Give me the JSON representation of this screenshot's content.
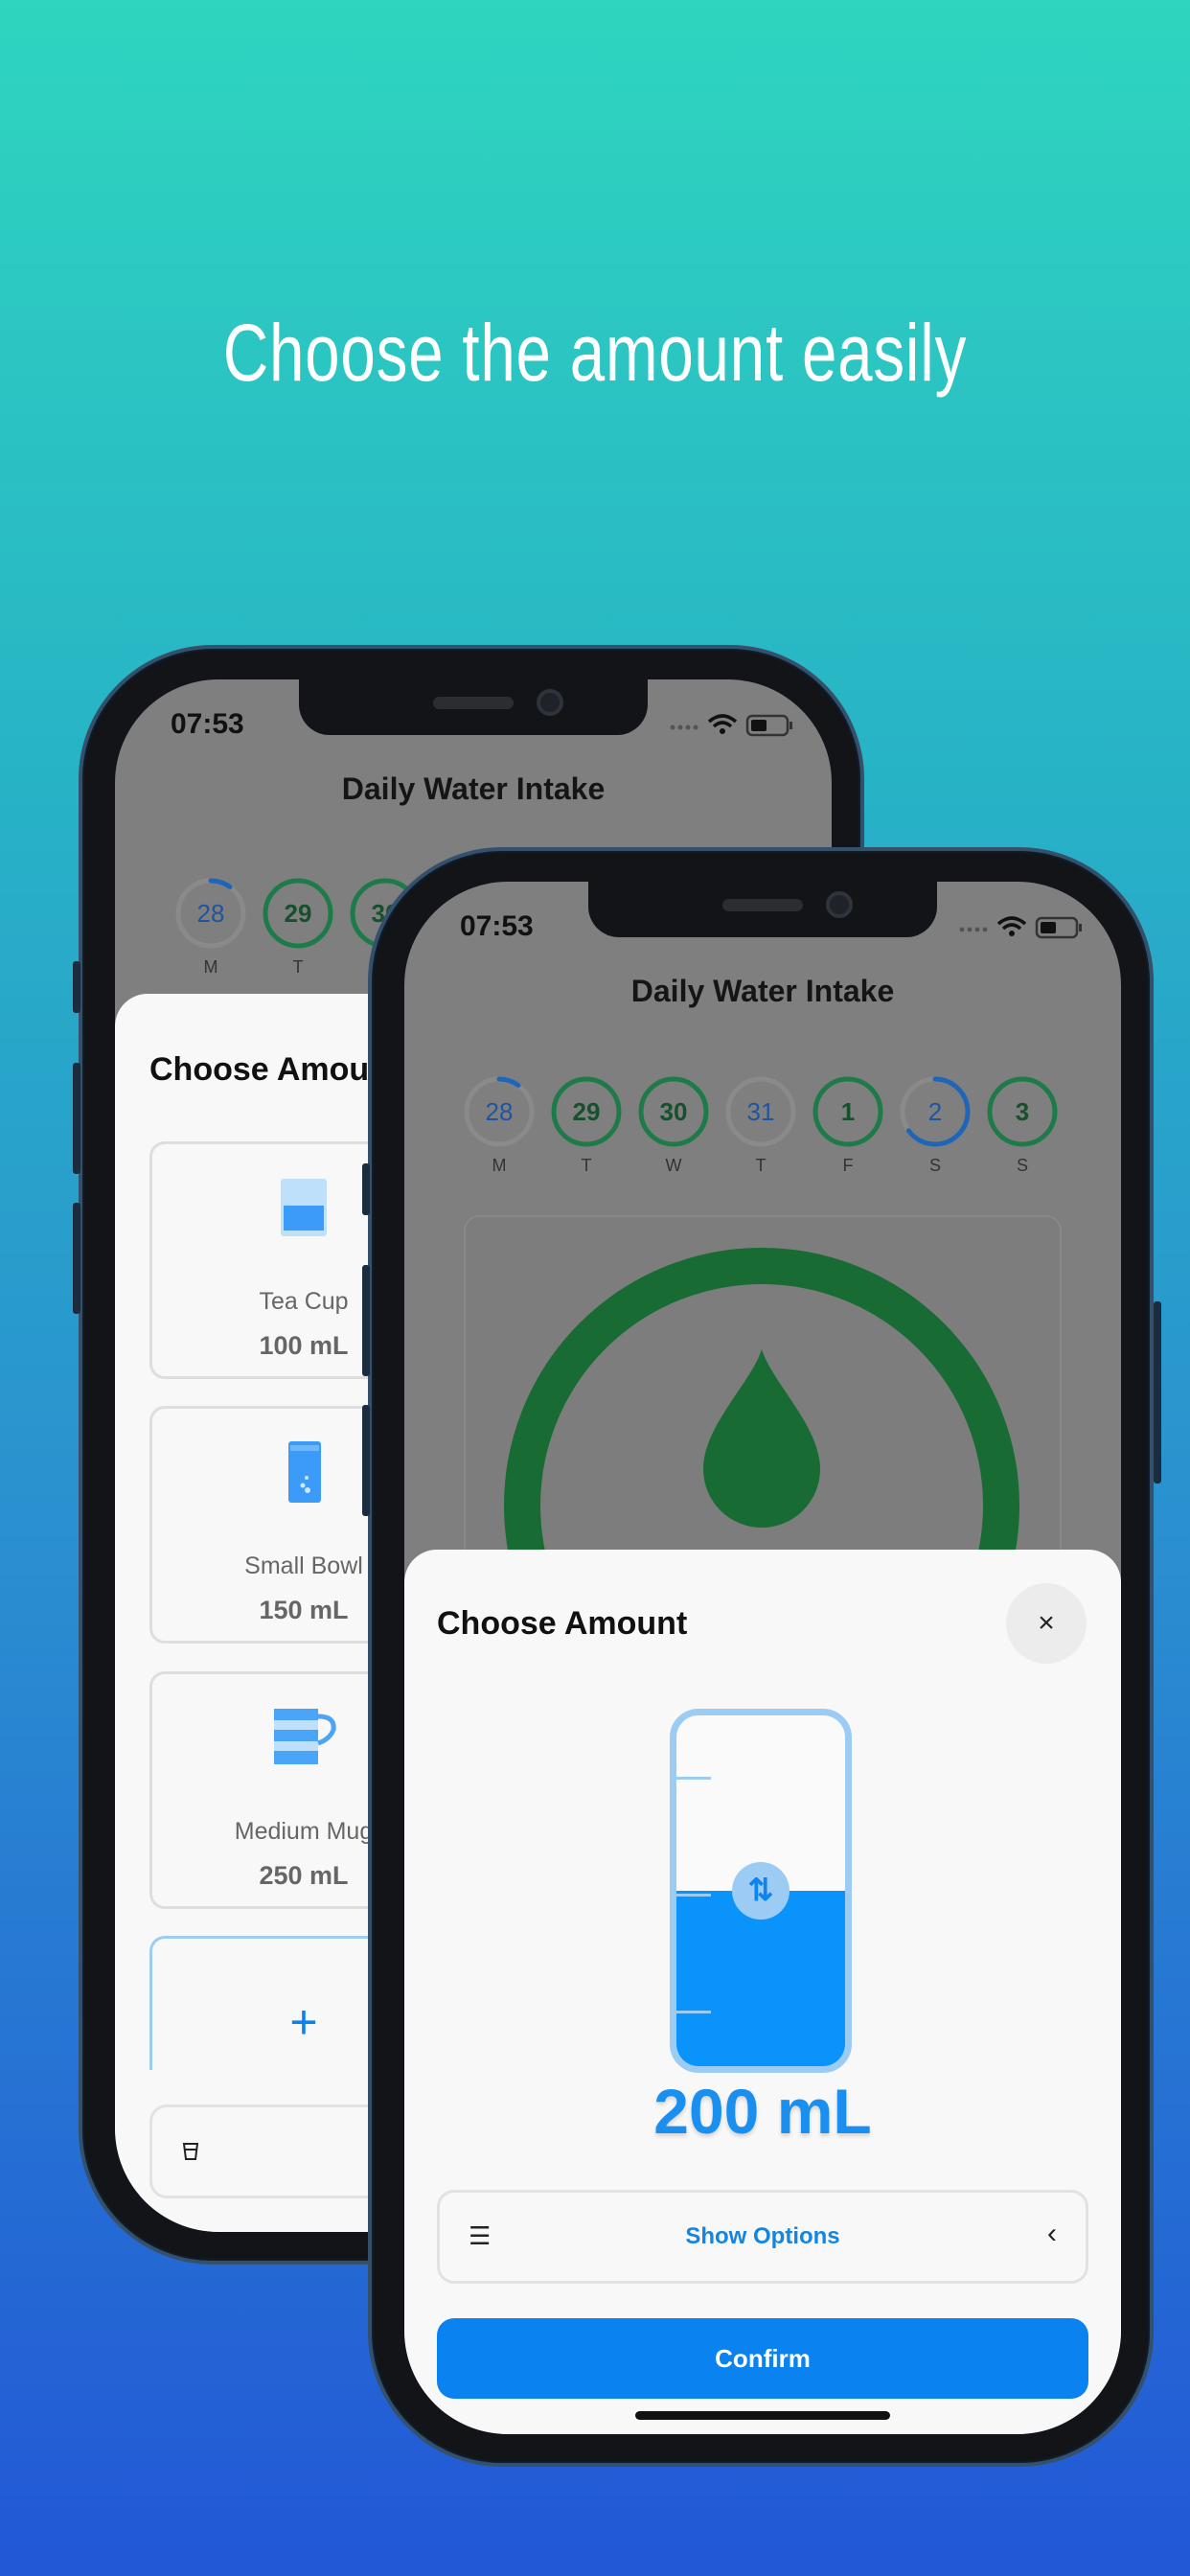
{
  "headline": "Choose the amount easily",
  "colors": {
    "accent": "#0a82f0",
    "water": "#0a93fb",
    "glass": "#9cccf4",
    "complete": "#1e7a48",
    "partial": "#1f66b8"
  },
  "status": {
    "time": "07:53",
    "icons": [
      "signal-dots-icon",
      "wifi-icon",
      "battery-icon"
    ]
  },
  "app": {
    "title": "Daily Water Intake"
  },
  "days": [
    {
      "num": "28",
      "letter": "M",
      "progress": 0.1
    },
    {
      "num": "29",
      "letter": "T",
      "progress": 1
    },
    {
      "num": "30",
      "letter": "W",
      "progress": 1
    },
    {
      "num": "31",
      "letter": "T",
      "progress": 0
    },
    {
      "num": "1",
      "letter": "F",
      "progress": 1
    },
    {
      "num": "2",
      "letter": "S",
      "progress": 0.65
    },
    {
      "num": "3",
      "letter": "S",
      "progress": 1
    }
  ],
  "back_sheet": {
    "title": "Choose Amount",
    "cards": [
      {
        "name": "Tea Cup",
        "amount": "100 mL",
        "icon": "tea-cup-icon"
      },
      {
        "name": "Small Bowl",
        "amount": "150 mL",
        "icon": "glass-icon"
      },
      {
        "name": "Medium Mug",
        "amount": "250 mL",
        "icon": "mug-icon"
      }
    ],
    "add_icon": "+"
  },
  "sheet": {
    "title": "Choose Amount",
    "close": "×",
    "amount": "200 mL",
    "fill_fraction": 0.5,
    "handle": "⇅",
    "show_options": "Show Options",
    "list_icon": "☰",
    "chevron": "‹",
    "confirm": "Confirm"
  }
}
